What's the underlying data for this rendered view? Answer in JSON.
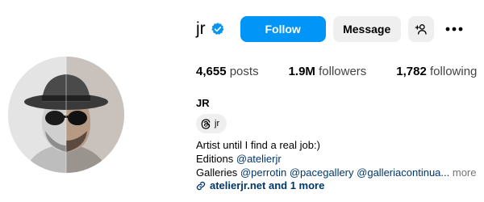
{
  "profile": {
    "username": "jr",
    "verified_icon": "verified-badge-icon",
    "full_name": "JR",
    "threads_handle": "jr"
  },
  "actions": {
    "follow_label": "Follow",
    "message_label": "Message",
    "add_user_icon": "add-person-icon",
    "more_icon": "more-options-icon"
  },
  "stats": {
    "posts_count": "4,655",
    "posts_label": "posts",
    "followers_count": "1.9M",
    "followers_label": "followers",
    "following_count": "1,782",
    "following_label": "following"
  },
  "bio": {
    "line1": "Artist until I find a real job:)",
    "line2_prefix": "Editions",
    "line2_mention": "@atelierjr",
    "line3_prefix": "Galleries",
    "line3_mentions": [
      "@perrotin",
      "@pacegallery",
      "@galleriacontinua..."
    ],
    "more_label": "more"
  },
  "link": {
    "text": "atelierjr.net and 1 more",
    "icon": "link-icon"
  },
  "colors": {
    "follow_button": "#0095f6",
    "secondary_button": "#efefef",
    "verified": "#0095f6",
    "mention": "#00376b",
    "muted": "#737373"
  }
}
